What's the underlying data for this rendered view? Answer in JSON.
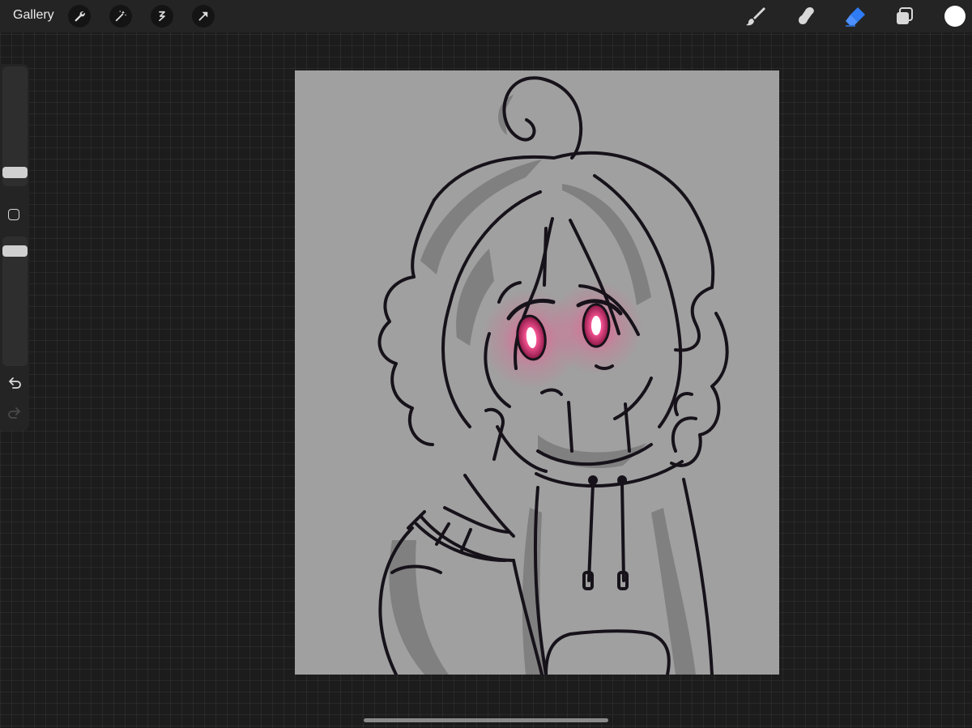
{
  "topbar": {
    "gallery_label": "Gallery",
    "left_tools": [
      "wrench-icon",
      "magic-wand-icon",
      "selection-icon",
      "transform-arrow-icon"
    ],
    "right_tools": [
      "brush-icon",
      "smudge-icon",
      "eraser-icon",
      "layers-icon",
      "color-icon"
    ],
    "active_tool": "eraser",
    "active_color": "#ffffff",
    "accent": "#2f7bf5"
  },
  "sidebar": {
    "controls": [
      "brush-size-slider",
      "modify-button",
      "opacity-slider",
      "undo-button",
      "redo-button"
    ],
    "redo_enabled": false
  },
  "canvas": {
    "background": "#a0a0a0",
    "subject": "character-drawing-with-glowing-pink-eyes"
  }
}
